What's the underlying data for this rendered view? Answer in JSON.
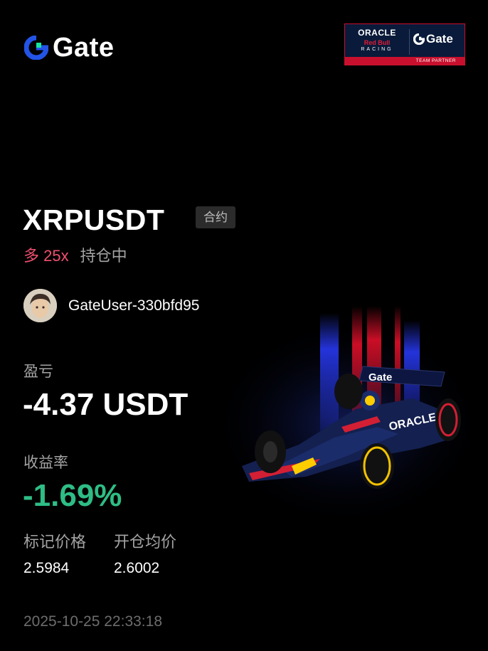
{
  "brand": {
    "logo_text": "Gate",
    "accent_color": "#2354e6",
    "highlight_color": "#17e5a1"
  },
  "partner": {
    "oracle": "ORACLE",
    "redbull": "Red Bull",
    "racing": "RACING",
    "brand": "Gate",
    "footer": "TEAM PARTNER"
  },
  "position": {
    "symbol": "XRPUSDT",
    "contract_badge": "合约",
    "side_leverage": "多 25x",
    "status": "持仓中",
    "side_color": "#f0506e"
  },
  "user": {
    "name": "GateUser-330bfd95"
  },
  "pnl": {
    "label": "盈亏",
    "value": "-4.37 USDT"
  },
  "roi": {
    "label": "收益率",
    "value": "-1.69%",
    "color": "#2ebd85"
  },
  "prices": {
    "mark_label": "标记价格",
    "mark_value": "2.5984",
    "entry_label": "开仓均价",
    "entry_value": "2.6002"
  },
  "timestamp": "2025-10-25 22:33:18",
  "car_livery": "ORACLE"
}
